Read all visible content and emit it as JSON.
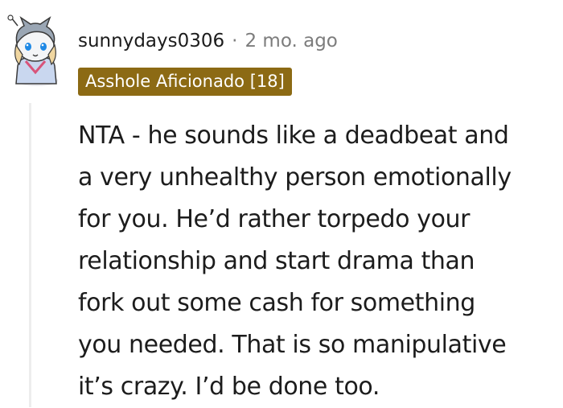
{
  "comment": {
    "username": "sunnydays0306",
    "separator": "·",
    "timestamp": "2 mo. ago",
    "flair": "Asshole Aficionado [18]",
    "body_lines": [
      "NTA - he sounds like a deadbeat and",
      "a very unhealthy person emotionally",
      "for you. He’d rather torpedo your",
      "relationship and start drama than",
      "fork out some cash for something",
      "you needed. That is so manipulative",
      "it’s crazy. I’d be done too."
    ]
  },
  "colors": {
    "flair_background": "#8c6a14",
    "flair_text": "#ffffff",
    "meta_text": "#7c7c7c",
    "body_text": "#1c1c1c",
    "thread_line": "#ededed"
  },
  "icons": {
    "avatar": "snoo-avatar-icon"
  }
}
